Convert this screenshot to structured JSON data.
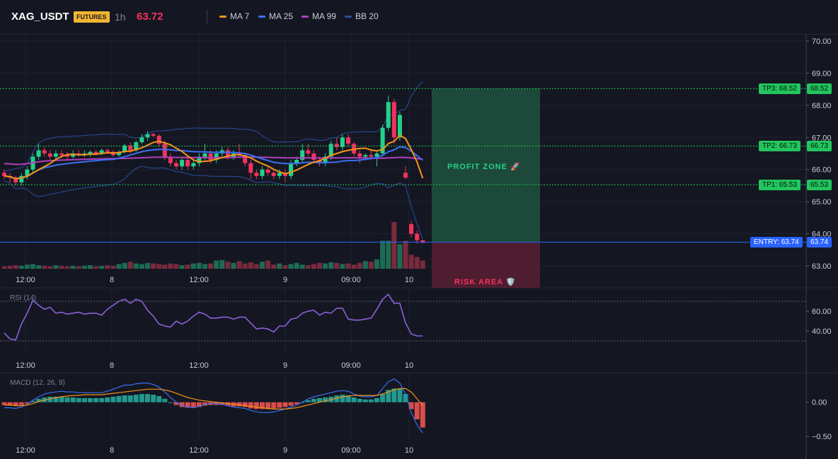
{
  "header": {
    "symbol": "XAG_USDT",
    "badge": "FUTURES",
    "timeframe": "1h",
    "last_price": "63.72",
    "indicators": [
      {
        "label": "MA 7",
        "color": "#f7931a"
      },
      {
        "label": "MA 25",
        "color": "#3b6ff2"
      },
      {
        "label": "MA 99",
        "color": "#b13fbd"
      },
      {
        "label": "BB 20",
        "color": "#2d4da0"
      }
    ]
  },
  "colors": {
    "up": "#23d18b",
    "down": "#f5325c",
    "profit_zone": "#1f5b41",
    "risk_zone": "#5c1f35",
    "rsi": "#8c5fd8",
    "macd_line": "#3b6ff2",
    "signal_line": "#f7931a",
    "tp": "#22c55e",
    "entry": "#2962ff"
  },
  "price_axis": {
    "ticks": [
      "70.00",
      "69.00",
      "68.00",
      "67.00",
      "66.00",
      "65.00",
      "64.00",
      "63.00"
    ]
  },
  "levels": {
    "tp3": {
      "label": "TP3: 68.52",
      "value": "68.52"
    },
    "tp2": {
      "label": "TP2: 66.73",
      "value": "66.73"
    },
    "tp1": {
      "label": "TP1: 65.53",
      "value": "65.53"
    },
    "entry": {
      "label": "ENTRY: 63.74",
      "value": "63.74"
    }
  },
  "zones": {
    "profit": "PROFIT ZONE 🚀",
    "risk": "RISK AREA 🛡️"
  },
  "time_axis": [
    "12:00",
    "8",
    "12:00",
    "9",
    "09:00",
    "10"
  ],
  "rsi": {
    "title": "RSI (14)",
    "ticks": [
      "60.00",
      "40.00"
    ]
  },
  "macd": {
    "title": "MACD (12, 26, 9)",
    "ticks": [
      "0.00",
      "−0.50"
    ]
  },
  "chart_data": {
    "type": "line",
    "title": "XAG_USDT",
    "ylim": [
      62.8,
      70.1
    ],
    "candles": [
      [
        65.9,
        66.0,
        65.7,
        65.8
      ],
      [
        65.8,
        65.9,
        65.6,
        65.75
      ],
      [
        65.75,
        65.8,
        65.5,
        65.6
      ],
      [
        65.6,
        65.9,
        65.5,
        65.8
      ],
      [
        65.8,
        66.1,
        65.7,
        66.0
      ],
      [
        66.0,
        66.5,
        65.9,
        66.4
      ],
      [
        66.4,
        66.8,
        66.3,
        66.6
      ],
      [
        66.6,
        66.7,
        66.4,
        66.5
      ],
      [
        66.5,
        66.6,
        66.3,
        66.4
      ],
      [
        66.4,
        66.6,
        66.3,
        66.5
      ],
      [
        66.5,
        66.6,
        66.35,
        66.45
      ],
      [
        66.45,
        66.55,
        66.3,
        66.4
      ],
      [
        66.4,
        66.6,
        66.35,
        66.5
      ],
      [
        66.5,
        66.6,
        66.4,
        66.45
      ],
      [
        66.45,
        66.6,
        66.4,
        66.5
      ],
      [
        66.5,
        66.6,
        66.4,
        66.55
      ],
      [
        66.55,
        66.6,
        66.45,
        66.5
      ],
      [
        66.5,
        66.65,
        66.45,
        66.6
      ],
      [
        66.6,
        66.65,
        66.5,
        66.55
      ],
      [
        66.55,
        66.6,
        66.4,
        66.45
      ],
      [
        66.45,
        66.6,
        66.4,
        66.55
      ],
      [
        66.55,
        66.8,
        66.5,
        66.75
      ],
      [
        66.75,
        66.85,
        66.5,
        66.6
      ],
      [
        66.6,
        66.9,
        66.55,
        66.85
      ],
      [
        66.85,
        67.1,
        66.8,
        67.0
      ],
      [
        67.0,
        67.2,
        66.9,
        67.1
      ],
      [
        67.1,
        67.15,
        67.0,
        67.05
      ],
      [
        67.05,
        67.1,
        66.7,
        66.8
      ],
      [
        66.8,
        66.9,
        66.3,
        66.4
      ],
      [
        66.4,
        66.5,
        66.1,
        66.2
      ],
      [
        66.2,
        66.3,
        66.0,
        66.1
      ],
      [
        66.1,
        66.4,
        66.0,
        66.3
      ],
      [
        66.3,
        66.4,
        66.0,
        66.1
      ],
      [
        66.1,
        66.3,
        66.0,
        66.2
      ],
      [
        66.2,
        66.5,
        66.1,
        66.4
      ],
      [
        66.4,
        66.8,
        66.3,
        66.5
      ],
      [
        66.5,
        66.6,
        66.2,
        66.3
      ],
      [
        66.3,
        66.6,
        66.2,
        66.5
      ],
      [
        66.5,
        66.7,
        66.4,
        66.6
      ],
      [
        66.6,
        66.7,
        66.3,
        66.4
      ],
      [
        66.4,
        66.6,
        66.3,
        66.5
      ],
      [
        66.5,
        66.8,
        66.4,
        66.45
      ],
      [
        66.45,
        66.5,
        66.1,
        66.2
      ],
      [
        66.2,
        66.3,
        65.7,
        65.9
      ],
      [
        65.9,
        66.0,
        65.7,
        65.8
      ],
      [
        65.8,
        66.1,
        65.7,
        66.0
      ],
      [
        66.0,
        66.1,
        65.8,
        65.9
      ],
      [
        65.9,
        66.0,
        65.7,
        65.8
      ],
      [
        65.8,
        66.0,
        65.7,
        65.9
      ],
      [
        65.9,
        66.0,
        65.6,
        65.8
      ],
      [
        65.8,
        66.3,
        65.7,
        66.2
      ],
      [
        66.2,
        66.4,
        66.1,
        66.3
      ],
      [
        66.3,
        66.8,
        66.2,
        66.6
      ],
      [
        66.6,
        66.8,
        66.4,
        66.5
      ],
      [
        66.5,
        66.6,
        66.2,
        66.3
      ],
      [
        66.3,
        66.4,
        66.1,
        66.2
      ],
      [
        66.2,
        66.5,
        66.1,
        66.4
      ],
      [
        66.4,
        66.9,
        66.3,
        66.8
      ],
      [
        66.8,
        67.0,
        66.6,
        66.7
      ],
      [
        66.7,
        67.1,
        66.6,
        67.0
      ],
      [
        67.0,
        67.1,
        66.7,
        66.8
      ],
      [
        66.8,
        66.85,
        66.4,
        66.5
      ],
      [
        66.5,
        66.6,
        66.2,
        66.4
      ],
      [
        66.4,
        66.5,
        66.3,
        66.45
      ],
      [
        66.45,
        66.6,
        66.3,
        66.4
      ],
      [
        66.4,
        66.6,
        66.1,
        66.5
      ],
      [
        66.5,
        67.4,
        66.4,
        67.3
      ],
      [
        67.3,
        68.3,
        67.2,
        68.1
      ],
      [
        68.1,
        68.2,
        66.8,
        67.0
      ],
      [
        67.0,
        67.8,
        66.9,
        67.7
      ],
      [
        65.9,
        66.1,
        65.7,
        65.75
      ],
      [
        64.3,
        64.4,
        63.9,
        64.0
      ],
      [
        64.0,
        64.1,
        63.7,
        63.8
      ],
      [
        63.8,
        63.8,
        63.7,
        63.72
      ]
    ],
    "volume": [
      4,
      5,
      6,
      5,
      7,
      8,
      6,
      5,
      4,
      6,
      5,
      4,
      5,
      4,
      5,
      6,
      4,
      5,
      6,
      5,
      8,
      10,
      12,
      9,
      8,
      10,
      9,
      8,
      7,
      9,
      8,
      6,
      7,
      9,
      10,
      8,
      9,
      14,
      15,
      12,
      10,
      13,
      9,
      11,
      8,
      12,
      14,
      7,
      9,
      6,
      8,
      10,
      7,
      6,
      8,
      10,
      9,
      11,
      10,
      8,
      9,
      7,
      10,
      13,
      12,
      16,
      48,
      48,
      80,
      42,
      48,
      24,
      20,
      14
    ],
    "rsi": [
      38,
      32,
      31,
      47,
      58,
      71,
      66,
      62,
      64,
      58,
      59,
      57,
      58,
      59,
      57,
      58,
      58,
      56,
      62,
      66,
      70,
      72,
      68,
      72,
      70,
      61,
      55,
      47,
      45,
      44,
      50,
      47,
      50,
      55,
      59,
      57,
      53,
      53,
      54,
      54,
      52,
      54,
      54,
      48,
      42,
      43,
      42,
      39,
      45,
      45,
      52,
      53,
      58,
      60,
      61,
      56,
      59,
      58,
      63,
      63,
      52,
      51,
      51,
      52,
      53,
      62,
      72,
      77,
      68,
      68,
      48,
      37,
      35,
      35
    ],
    "macd_hist": [
      -0.04,
      -0.05,
      -0.05,
      -0.04,
      -0.02,
      0.02,
      0.05,
      0.07,
      0.08,
      0.08,
      0.08,
      0.07,
      0.07,
      0.06,
      0.06,
      0.06,
      0.06,
      0.06,
      0.07,
      0.08,
      0.09,
      0.1,
      0.1,
      0.11,
      0.12,
      0.12,
      0.11,
      0.09,
      0.05,
      0.0,
      -0.04,
      -0.07,
      -0.08,
      -0.08,
      -0.07,
      -0.05,
      -0.04,
      -0.04,
      -0.04,
      -0.05,
      -0.06,
      -0.06,
      -0.07,
      -0.09,
      -0.1,
      -0.1,
      -0.1,
      -0.09,
      -0.08,
      -0.07,
      -0.05,
      -0.03,
      0.0,
      0.03,
      0.05,
      0.06,
      0.07,
      0.08,
      0.1,
      0.11,
      0.1,
      0.07,
      0.05,
      0.04,
      0.04,
      0.06,
      0.12,
      0.18,
      0.2,
      0.2,
      0.12,
      -0.1,
      -0.25,
      -0.37
    ],
    "macd_line": [
      -0.08,
      -0.08,
      -0.09,
      -0.07,
      -0.03,
      0.03,
      0.08,
      0.12,
      0.14,
      0.15,
      0.16,
      0.15,
      0.15,
      0.14,
      0.14,
      0.14,
      0.14,
      0.14,
      0.16,
      0.19,
      0.22,
      0.25,
      0.25,
      0.27,
      0.28,
      0.28,
      0.26,
      0.22,
      0.15,
      0.07,
      0.0,
      -0.05,
      -0.07,
      -0.08,
      -0.06,
      -0.03,
      -0.02,
      -0.02,
      -0.03,
      -0.05,
      -0.07,
      -0.08,
      -0.09,
      -0.12,
      -0.14,
      -0.15,
      -0.15,
      -0.14,
      -0.12,
      -0.1,
      -0.07,
      -0.04,
      0.0,
      0.05,
      0.08,
      0.1,
      0.12,
      0.14,
      0.16,
      0.17,
      0.16,
      0.12,
      0.09,
      0.08,
      0.08,
      0.1,
      0.2,
      0.3,
      0.34,
      0.28,
      0.12,
      -0.15,
      -0.33,
      -0.45
    ],
    "signal_line": [
      -0.04,
      -0.04,
      -0.05,
      -0.05,
      -0.04,
      -0.02,
      0.01,
      0.03,
      0.05,
      0.07,
      0.08,
      0.09,
      0.1,
      0.1,
      0.11,
      0.11,
      0.11,
      0.11,
      0.12,
      0.13,
      0.14,
      0.15,
      0.16,
      0.17,
      0.18,
      0.19,
      0.19,
      0.19,
      0.18,
      0.16,
      0.13,
      0.1,
      0.07,
      0.05,
      0.03,
      0.02,
      0.01,
      0.0,
      -0.01,
      -0.02,
      -0.03,
      -0.04,
      -0.05,
      -0.06,
      -0.07,
      -0.08,
      -0.09,
      -0.1,
      -0.1,
      -0.1,
      -0.09,
      -0.08,
      -0.06,
      -0.04,
      -0.02,
      0.0,
      0.02,
      0.04,
      0.06,
      0.08,
      0.09,
      0.1,
      0.1,
      0.1,
      0.1,
      0.1,
      0.12,
      0.15,
      0.18,
      0.2,
      0.2,
      0.15,
      0.05,
      -0.05
    ],
    "rsi_ylim": [
      20,
      80
    ],
    "macd_ylim": [
      -0.55,
      0.4
    ]
  }
}
